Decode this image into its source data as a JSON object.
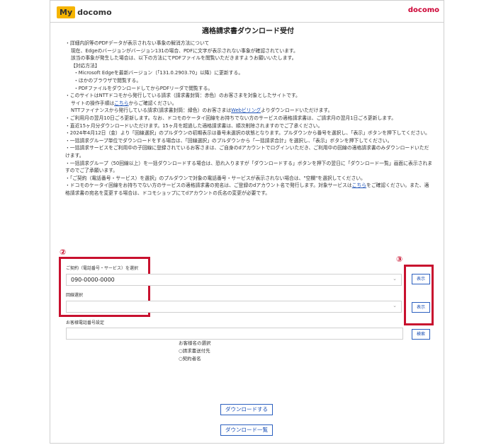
{
  "header": {
    "logo_my": "My",
    "logo_docomo": "docomo",
    "brand": "docomo"
  },
  "page_title": "適格請求書ダウンロード受付",
  "notes": [
    "・詳細内訳等のPDFデータが表示されない事象の解消方法について",
    "現在、Edgeのバージョンがバージョン131の場合、PDFに文字が表示されない事象が確認されています。",
    "該当の事象が発生した場合は、以下の方法にてPDFファイルを閲覧いただきますようお願いいたします。",
    "【対応方法】",
    "・Microsoft Edgeを最新バージョン（「131.0.2903.70」以降）に更新する。",
    "・ほかのブラウザで閲覧する。",
    "・PDFファイルをダウンロードしてからPDFリーダで閲覧する。",
    "・このサイトはNTTドコモから発行している請求（請求書封筒：赤色）のお客さまを対象としたサイトです。",
    "サイトの操作手順は",
    "こちら",
    "からご確認ください。",
    "NTTファイナンスから発行している請求(請求書封筒：緑色）のお客さまは",
    "Webビリング",
    "よりダウンロードいただけます。",
    "・ご利用月の翌月10日ごろ更新します。なお、ドコモのケータイ回線をお持ちでない方のサービスの適格請求書は、ご請求月の翌月1日ごろ更新します。",
    "・直近15ヶ月分ダウンロードいただけます。15ヶ月を超過した適格請求書は、順次削除されますのでご了承ください。",
    "・2024年4月12日（金）より「回線選択」のプルダウンの初期表示は番号未選択の状態となります。プルダウンから番号を選択し、「表示」ボタンを押下してください。",
    "・一括請求グループ単位でダウンロードをする場合は、「回線選択」のプルダウンから「一括請求合計」を選択し、「表示」ボタンを押下してください。",
    "・一括請求サービスをご利用中の子回線に登録されているお客さまは、ご自身のdアカウントでログインいただき、ご利用中の回線の適格請求書のみダウンロードいただけます。",
    "・一括請求グループ（50回線以上）を一括ダウンロードする場合は、恐れ入りますが「ダウンロードする」ボタンを押下の翌日に「ダウンロード一覧」画面に表示されますのでご了承願います。",
    "・「ご契約（電話番号・サービス）を選択」のプルダウンで対象の電話番号・サービスが表示されない場合は、\"空欄\"を選択してください。",
    "・ドコモのケータイ回線をお持ちでない方のサービスの適格請求書の宛名は、ご登録のdアカウント名で発行します。対象サービスは",
    "こちら",
    "をご確認ください。また、適格請求書の宛名を変更する場合は、ドコモショップにてdアカウントの氏名の変更が必要です。"
  ],
  "markers": {
    "two": "②",
    "three": "③"
  },
  "form": {
    "contract_label": "ご契約（電話番号・サービス）を選択",
    "contract_value": "090-0000-0000",
    "line_label": "回線選択",
    "line_value": "",
    "phone_setting_label": "お客様電話番号設定",
    "phone_setting_value": "",
    "show_button_1": "表示",
    "show_button_2": "表示",
    "search_button": "検索",
    "name_select_label": "お客様名の選択",
    "radio_1": "○請求書送付先",
    "radio_2": "○契約者名",
    "download_button": "ダウンロードする",
    "download_list_button": "ダウンロード一覧"
  }
}
